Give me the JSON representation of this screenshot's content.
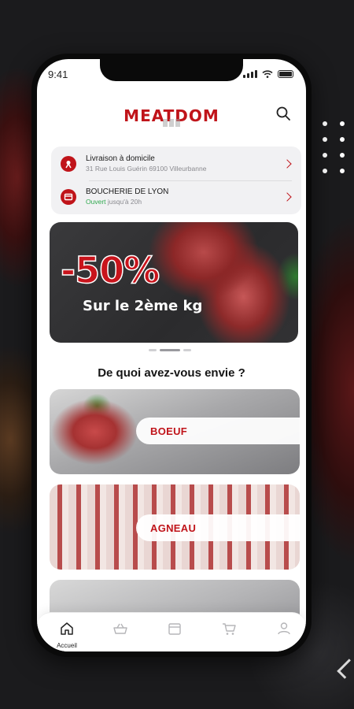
{
  "status_bar": {
    "time": "9:41"
  },
  "app": {
    "logo": "MEATDOM",
    "brand_color": "#c0141a"
  },
  "delivery": {
    "title": "Livraison à domicile",
    "address": "31 Rue Louis Guérin 69100 Villeurbanne"
  },
  "shop": {
    "name": "BOUCHERIE DE LYON",
    "status": "Ouvert",
    "status_suffix": "jusqu'à 20h",
    "status_color": "#2fa94e"
  },
  "banner": {
    "discount": "-50%",
    "subtitle": "Sur le 2ème kg"
  },
  "carousel": {
    "active_index": 1,
    "count": 3
  },
  "section": {
    "title": "De quoi avez-vous envie ?"
  },
  "categories": [
    {
      "label": "BOEUF"
    },
    {
      "label": "AGNEAU"
    }
  ],
  "tabbar": {
    "items": [
      {
        "label": "Accueil",
        "icon": "home-icon",
        "active": true
      },
      {
        "label": "",
        "icon": "basket-icon"
      },
      {
        "label": "",
        "icon": "store-icon"
      },
      {
        "label": "",
        "icon": "cart-icon"
      },
      {
        "label": "",
        "icon": "user-icon"
      }
    ]
  }
}
